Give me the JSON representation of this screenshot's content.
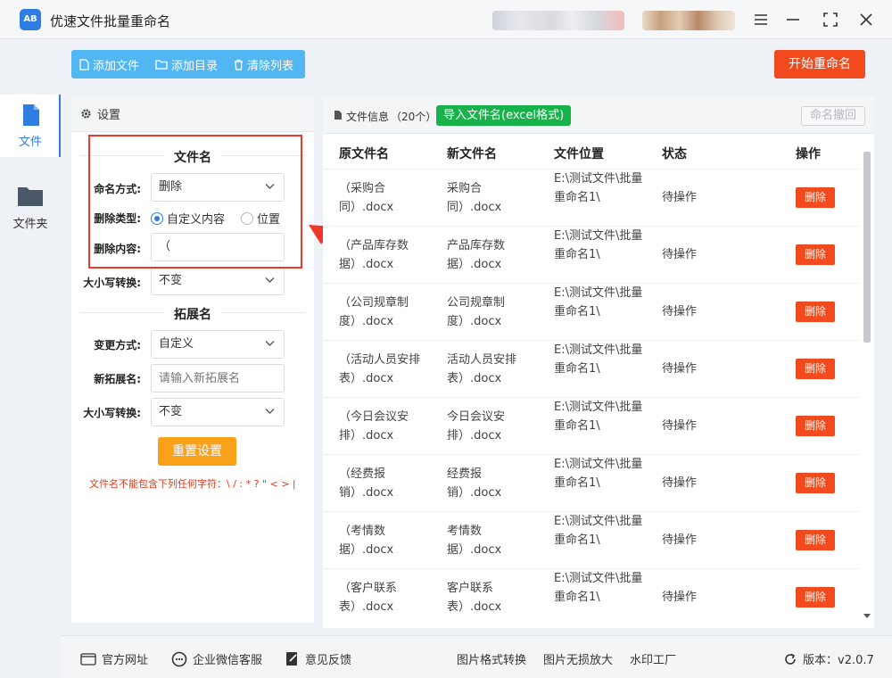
{
  "app": {
    "title": "优速文件批量重命名",
    "logo_text": "AB"
  },
  "toolbar": {
    "add_file": "添加文件",
    "add_dir": "添加目录",
    "clear_list": "清除列表",
    "start": "开始重命名"
  },
  "sidebar": {
    "items": [
      {
        "label": "文件",
        "icon": "file-icon",
        "active": true
      },
      {
        "label": "文件夹",
        "icon": "folder-icon",
        "active": false
      }
    ]
  },
  "settings": {
    "header": "设置",
    "filename_section": "文件名",
    "naming_mode_label": "命名方式:",
    "naming_mode_value": "删除",
    "delete_type_label": "删除类型:",
    "delete_type_options": [
      "自定义内容",
      "位置"
    ],
    "delete_type_selected": "自定义内容",
    "delete_content_label": "删除内容:",
    "delete_content_value": "（",
    "case_label": "大小写转换:",
    "case_value": "不变",
    "ext_section": "拓展名",
    "change_mode_label": "变更方式:",
    "change_mode_value": "自定义",
    "new_ext_label": "新拓展名:",
    "new_ext_placeholder": "请输入新拓展名",
    "ext_case_label": "大小写转换:",
    "ext_case_value": "不变",
    "reset_button": "重置设置",
    "warning": "文件名不能包含下列任何字符：\\ / : * ? \" < > |"
  },
  "files": {
    "header": "文件信息",
    "count": "（20个）",
    "import_button": "导入文件名(excel格式)",
    "undo_button": "命名撤回",
    "columns": [
      "原文件名",
      "新文件名",
      "文件位置",
      "状态",
      "操作"
    ],
    "rows": [
      {
        "orig": "（采购合同）.docx",
        "new": "采购合同）.docx",
        "path": "E:\\测试文件\\批量重命名1\\",
        "status": "待操作",
        "action": "删除"
      },
      {
        "orig": "（产品库存数据）.docx",
        "new": "产品库存数据）.docx",
        "path": "E:\\测试文件\\批量重命名1\\",
        "status": "待操作",
        "action": "删除"
      },
      {
        "orig": "（公司规章制度）.docx",
        "new": "公司规章制度）.docx",
        "path": "E:\\测试文件\\批量重命名1\\",
        "status": "待操作",
        "action": "删除"
      },
      {
        "orig": "（活动人员安排表）.docx",
        "new": "活动人员安排表）.docx",
        "path": "E:\\测试文件\\批量重命名1\\",
        "status": "待操作",
        "action": "删除"
      },
      {
        "orig": "（今日会议安排）.docx",
        "new": "今日会议安排）.docx",
        "path": "E:\\测试文件\\批量重命名1\\",
        "status": "待操作",
        "action": "删除"
      },
      {
        "orig": "（经费报销）.docx",
        "new": "经费报销）.docx",
        "path": "E:\\测试文件\\批量重命名1\\",
        "status": "待操作",
        "action": "删除"
      },
      {
        "orig": "（考情数据）.docx",
        "new": "考情数据）.docx",
        "path": "E:\\测试文件\\批量重命名1\\",
        "status": "待操作",
        "action": "删除"
      },
      {
        "orig": "（客户联系表）.docx",
        "new": "客户联系表）.docx",
        "path": "E:\\测试文件\\批量重命名1\\",
        "status": "待操作",
        "action": "删除"
      }
    ]
  },
  "bottom": {
    "links": [
      "官方网址",
      "企业微信客服",
      "意见反馈",
      "图片格式转换",
      "图片无损放大",
      "水印工厂"
    ],
    "version": "版本：v2.0.7"
  },
  "colors": {
    "accent": "#2f7de1",
    "danger": "#f04a1e",
    "toolbar": "#52b6f2",
    "import": "#18b24b",
    "reset": "#f9a118"
  }
}
